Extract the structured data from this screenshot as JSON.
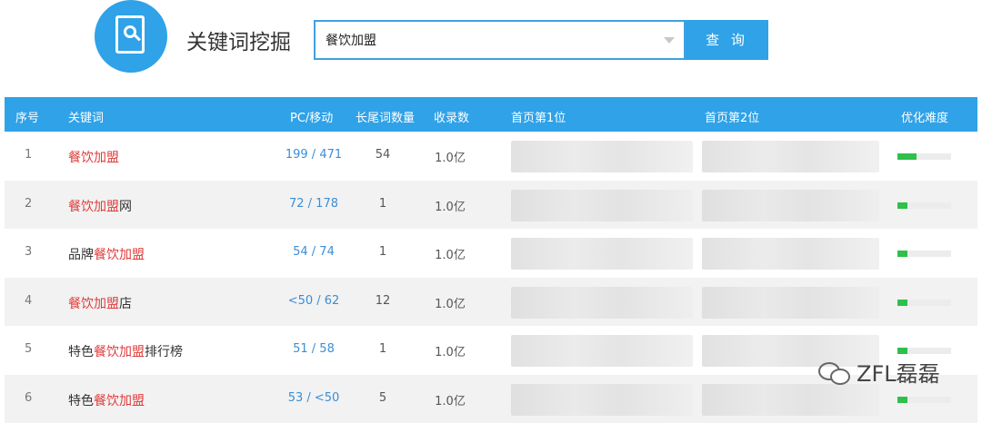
{
  "tool": {
    "title": "关键词挖掘",
    "logo_icon": "document-magnifier-icon",
    "accent_color": "#2fa2e8"
  },
  "search": {
    "value": "餐饮加盟",
    "button_label": "查 询"
  },
  "table": {
    "headers": {
      "index": "序号",
      "keyword": "关键词",
      "pc_mobile": "PC/移动",
      "longtail": "长尾词数量",
      "indexed": "收录数",
      "rank1": "首页第1位",
      "rank2": "首页第2位",
      "difficulty": "优化难度"
    },
    "rows": [
      {
        "index": "1",
        "kw_pre": "",
        "kw_hl": "餐饮加盟",
        "kw_post": "",
        "pc_mobile": "199 / 471",
        "longtail": "54",
        "indexed": "1.0亿",
        "difficulty": 0.35
      },
      {
        "index": "2",
        "kw_pre": "",
        "kw_hl": "餐饮加盟",
        "kw_post": "网",
        "pc_mobile": "72 / 178",
        "longtail": "1",
        "indexed": "1.0亿",
        "difficulty": 0.18
      },
      {
        "index": "3",
        "kw_pre": "品牌",
        "kw_hl": "餐饮加盟",
        "kw_post": "",
        "pc_mobile": "54 / 74",
        "longtail": "1",
        "indexed": "1.0亿",
        "difficulty": 0.18
      },
      {
        "index": "4",
        "kw_pre": "",
        "kw_hl": "餐饮加盟",
        "kw_post": "店",
        "pc_mobile": "<50 / 62",
        "longtail": "12",
        "indexed": "1.0亿",
        "difficulty": 0.18
      },
      {
        "index": "5",
        "kw_pre": "特色",
        "kw_hl": "餐饮加盟",
        "kw_post": "排行榜",
        "pc_mobile": "51 / 58",
        "longtail": "1",
        "indexed": "1.0亿",
        "difficulty": 0.18
      },
      {
        "index": "6",
        "kw_pre": "特色",
        "kw_hl": "餐饮加盟",
        "kw_post": "",
        "pc_mobile": "53 / <50",
        "longtail": "5",
        "indexed": "1.0亿",
        "difficulty": 0.18
      }
    ]
  },
  "watermark": {
    "text": "ZFL磊磊",
    "icon": "wechat-icon"
  }
}
